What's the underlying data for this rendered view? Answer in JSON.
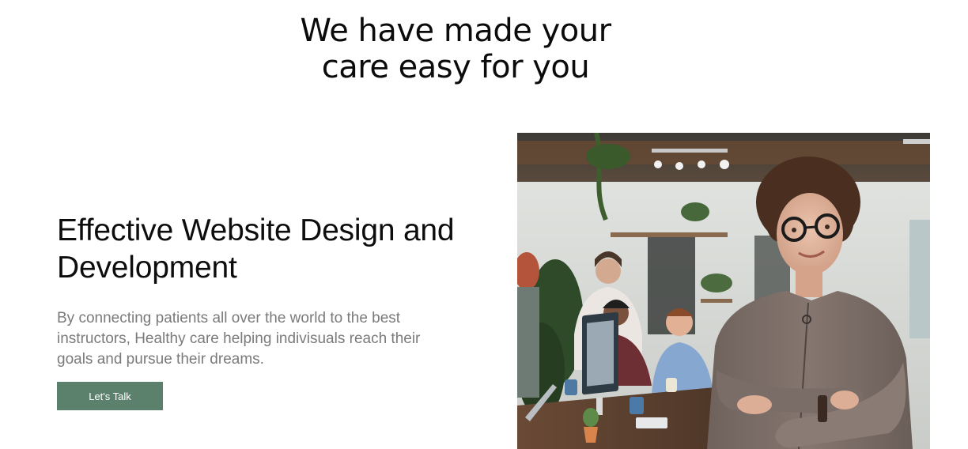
{
  "hero": {
    "title_line1": "We have made your",
    "title_line2": "care easy for you"
  },
  "feature": {
    "heading": "Effective Website Design and Development",
    "description": "By connecting patients all over the world to the best instructors, Healthy care helping indivisuals reach their goals and pursue their dreams.",
    "cta_label": "Let's Talk"
  },
  "colors": {
    "button_bg": "#5b806c",
    "heading_text": "#0d0d0d",
    "body_text": "#7a7a7a"
  }
}
